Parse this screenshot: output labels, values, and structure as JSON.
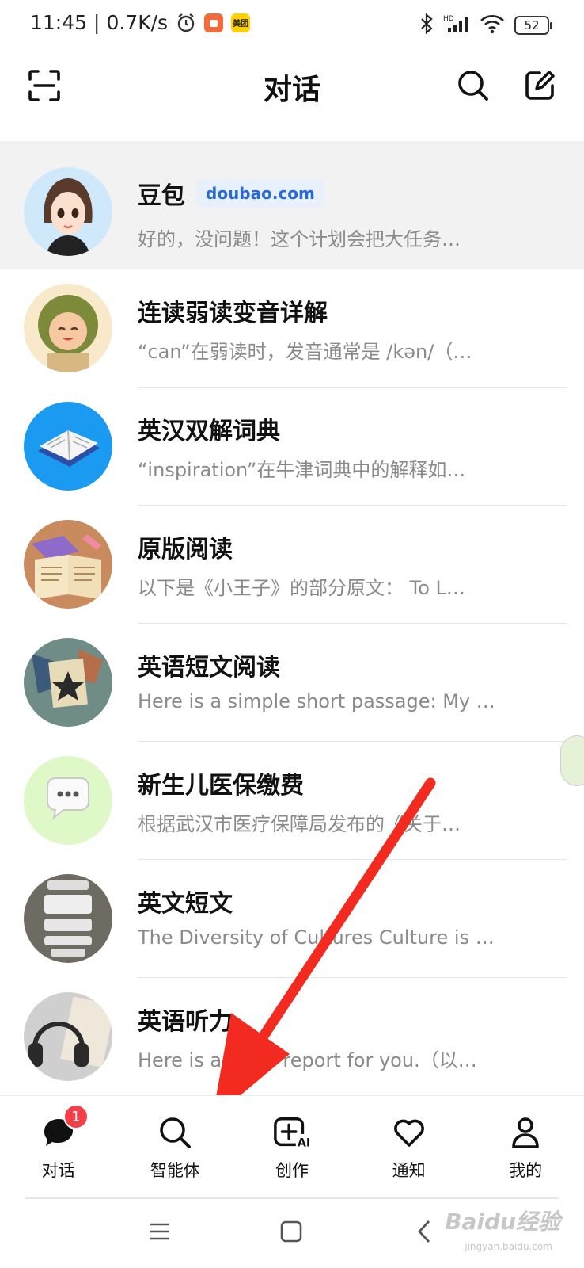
{
  "status_bar": {
    "time": "11:45",
    "speed": "0.7K/s",
    "meituan": "美团",
    "battery": "52"
  },
  "header": {
    "title": "对话"
  },
  "conversations": [
    {
      "title": "豆包",
      "badge": "doubao.com",
      "preview": "好的，没问题！这个计划会把大任务…"
    },
    {
      "title": "连读弱读变音详解",
      "preview": "“can”在弱读时，发音通常是 /kən/（…"
    },
    {
      "title": "英汉双解词典",
      "preview": "“inspiration”在牛津词典中的解释如…"
    },
    {
      "title": "原版阅读",
      "preview": "以下是《小王子》的部分原文： To L…"
    },
    {
      "title": "英语短文阅读",
      "preview": "Here is a simple short passage: My …"
    },
    {
      "title": "新生儿医保缴费",
      "preview": "根据武汉市医疗保障局发布的《关于…"
    },
    {
      "title": "英文短文",
      "preview": "The Diversity of Cultures Culture is …"
    },
    {
      "title": "英语听力",
      "preview": "Here is a news report for you.（以…"
    }
  ],
  "bottom_nav": {
    "items": [
      {
        "label": "对话",
        "badge": "1"
      },
      {
        "label": "智能体"
      },
      {
        "label": "创作"
      },
      {
        "label": "通知"
      },
      {
        "label": "我的"
      }
    ]
  },
  "watermark": {
    "brand": "Baidu经验",
    "url": "jingyan.baidu.com"
  },
  "colors": {
    "accent_blue": "#2a6ad8",
    "badge_red": "#f43f4a",
    "arrow_red": "#f22a1f"
  }
}
